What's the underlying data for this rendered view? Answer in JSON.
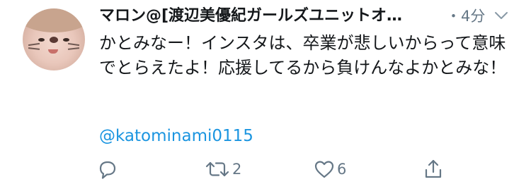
{
  "tweet": {
    "display_name": "マロン@[渡辺美優紀ガールズユニットオ…",
    "timestamp": "・4分",
    "text": "かとみなー！インスタは、卒業が悲しいからって意味でとらえたよ！応援してるから負けんなよかとみな！",
    "mention": "@katominami0115",
    "avatar_icon": "avatar-photo",
    "menu_icon": "chevron-down-icon",
    "colors": {
      "text": "#14171a",
      "muted": "#657786",
      "link": "#1b95e0"
    }
  },
  "actions": {
    "reply": {
      "icon": "reply-icon",
      "count": ""
    },
    "retweet": {
      "icon": "retweet-icon",
      "count": "2"
    },
    "like": {
      "icon": "heart-icon",
      "count": "6"
    },
    "share": {
      "icon": "share-icon"
    }
  }
}
